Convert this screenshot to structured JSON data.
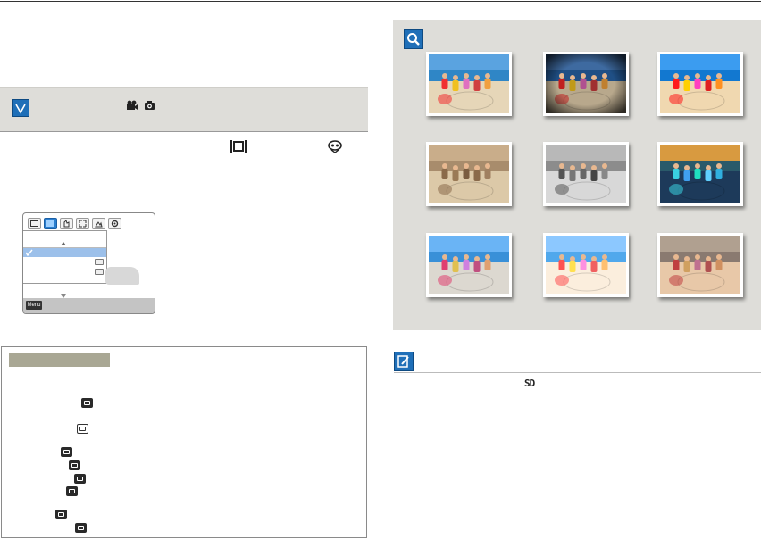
{
  "document": {
    "lcd_menu_label": "Menu",
    "badge_label": "SD"
  },
  "colors": {
    "accent_blue": "#1f6fb8",
    "note_bar_bg": "#deddd9",
    "tips_header_bg": "#a9a794",
    "lcd_selected_row": "#9cc0ea"
  },
  "icons": {
    "note_bar": [
      "check-icon",
      "movie-camera-icon",
      "photo-camera-icon"
    ],
    "inline": [
      "frame-mode-icon",
      "scene-mode-icon"
    ],
    "lcd_tabs": [
      "photo-size-icon",
      "color-effect-icon",
      "hand-icon",
      "stabilizer-icon",
      "scene-icon",
      "settings-icon"
    ],
    "right": [
      "magnify-icon",
      "memo-icon"
    ]
  },
  "samples": {
    "count": 9,
    "effects": [
      "normal",
      "vignette",
      "vivid",
      "sepia",
      "black-and-white",
      "negative",
      "cool",
      "bright",
      "warm"
    ]
  }
}
